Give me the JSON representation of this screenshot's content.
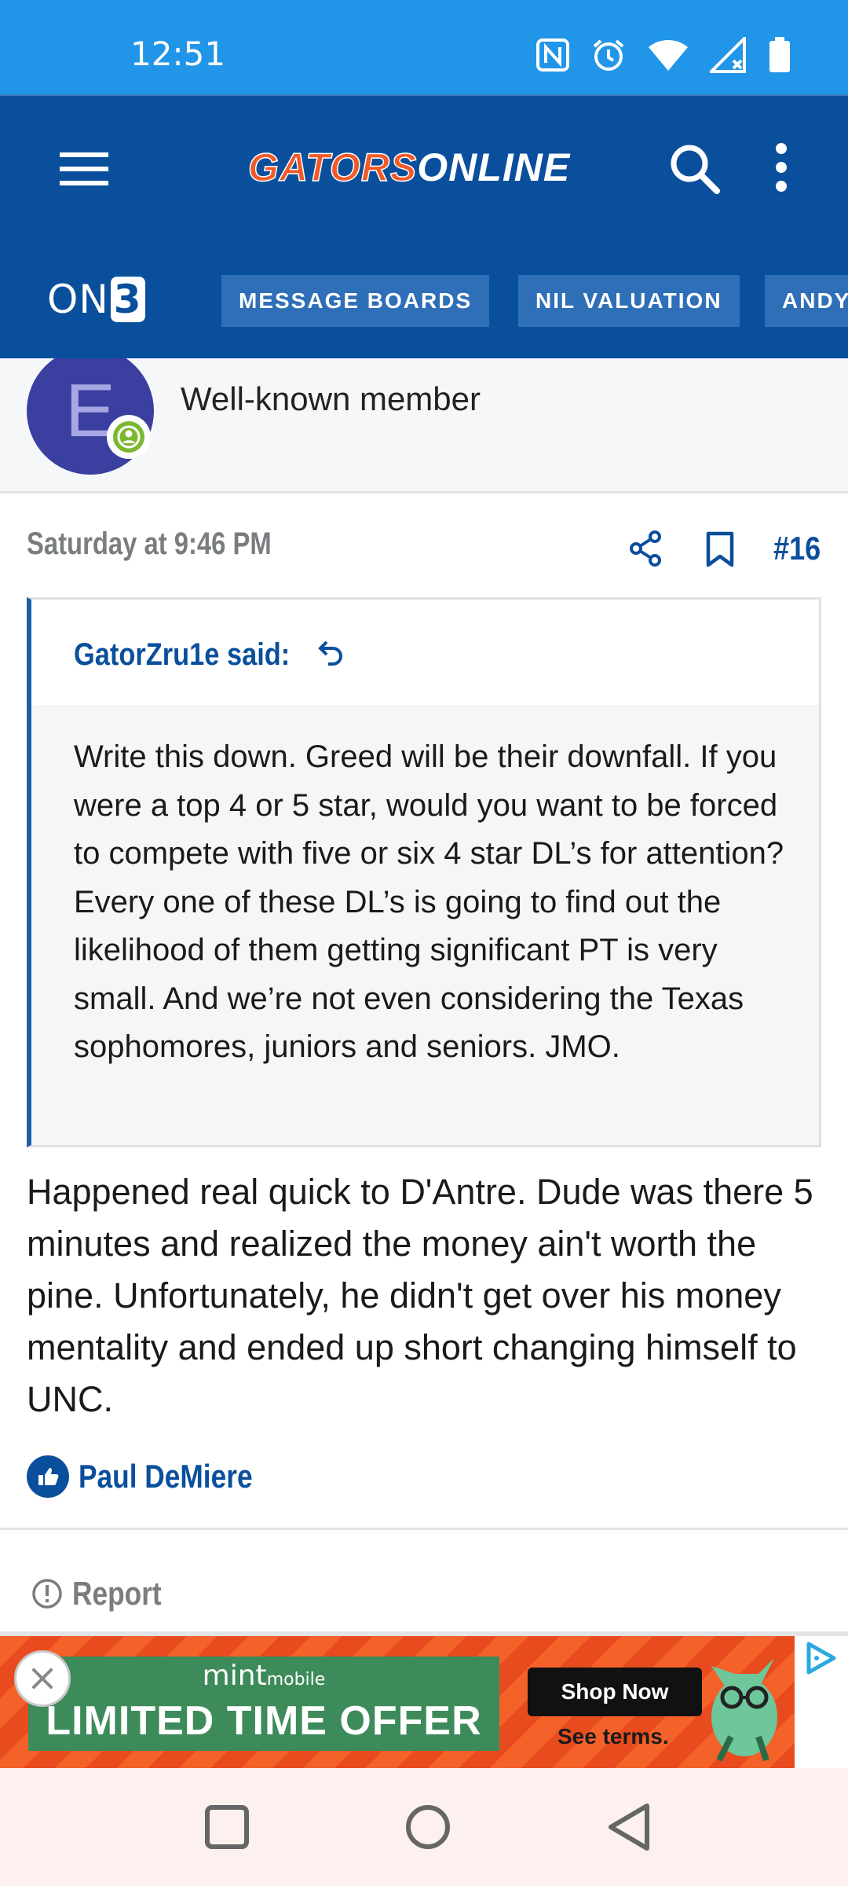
{
  "status_bar": {
    "time": "12:51",
    "icons": [
      "nfc-icon",
      "alarm-icon",
      "wifi-icon",
      "signal-icon",
      "battery-icon"
    ]
  },
  "header": {
    "logo_part1": "GATORS",
    "logo_part2": "ONLINE",
    "network_logo": "ON",
    "network_logo_suffix": "3",
    "nav": [
      "MESSAGE BOARDS",
      "NIL VALUATION",
      "ANDY"
    ]
  },
  "member": {
    "avatar_letter": "E",
    "role": "Well-known member"
  },
  "post": {
    "timestamp": "Saturday at 9:46 PM",
    "number": "#16",
    "quote": {
      "author": "GatorZru1e said:",
      "text": "Write this down. Greed will be their downfall. If you were a top 4 or 5 star, would you want to be forced to compete with five or six 4 star DL’s for attention? Every one of these DL’s is going to find out the likelihood of them getting significant PT is very small. And we’re not even considering the Texas sophomores, juniors and seniors. JMO."
    },
    "body": "Happened real quick to D'Antre. Dude was there 5 minutes and realized the money ain't worth the pine. Unfortunately, he didn't get over his money mentality and ended up short changing himself to UNC.",
    "reaction_user": "Paul DeMiere",
    "report_label": "Report"
  },
  "ad": {
    "brand": "mint",
    "brand_suffix": "mobile",
    "offer": "LIMITED TIME OFFER",
    "cta": "Shop Now",
    "terms": "See terms."
  },
  "colors": {
    "status_bar": "#2196e8",
    "header": "#0a4f9c",
    "logo_orange": "#f05a28",
    "link_blue": "#0a4f9c"
  }
}
